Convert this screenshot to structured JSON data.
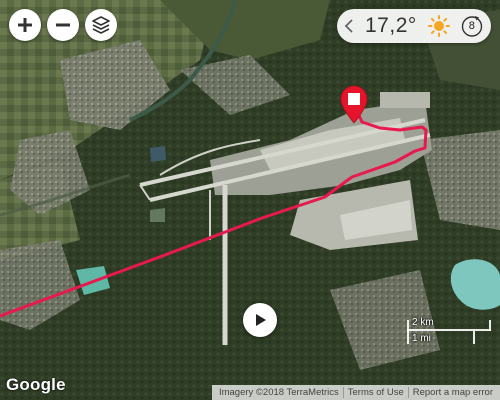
{
  "map": {
    "imagery_credit": "Imagery ©2018 TerraMetrics",
    "terms_link": "Terms of Use",
    "report_link": "Report a map error",
    "logo": "Google",
    "route_color": "#e8194d",
    "pin_color": "#e5142b"
  },
  "controls": {
    "zoom_in_icon": "plus-icon",
    "zoom_out_icon": "minus-icon",
    "layers_icon": "layers-icon",
    "play_icon": "play-icon"
  },
  "weather": {
    "temperature": "17,2°",
    "condition_icon": "sun-icon",
    "wind_value": "8",
    "sun_color": "#f5a623"
  },
  "scale": {
    "metric": "2 km",
    "imperial": "1 mi"
  }
}
